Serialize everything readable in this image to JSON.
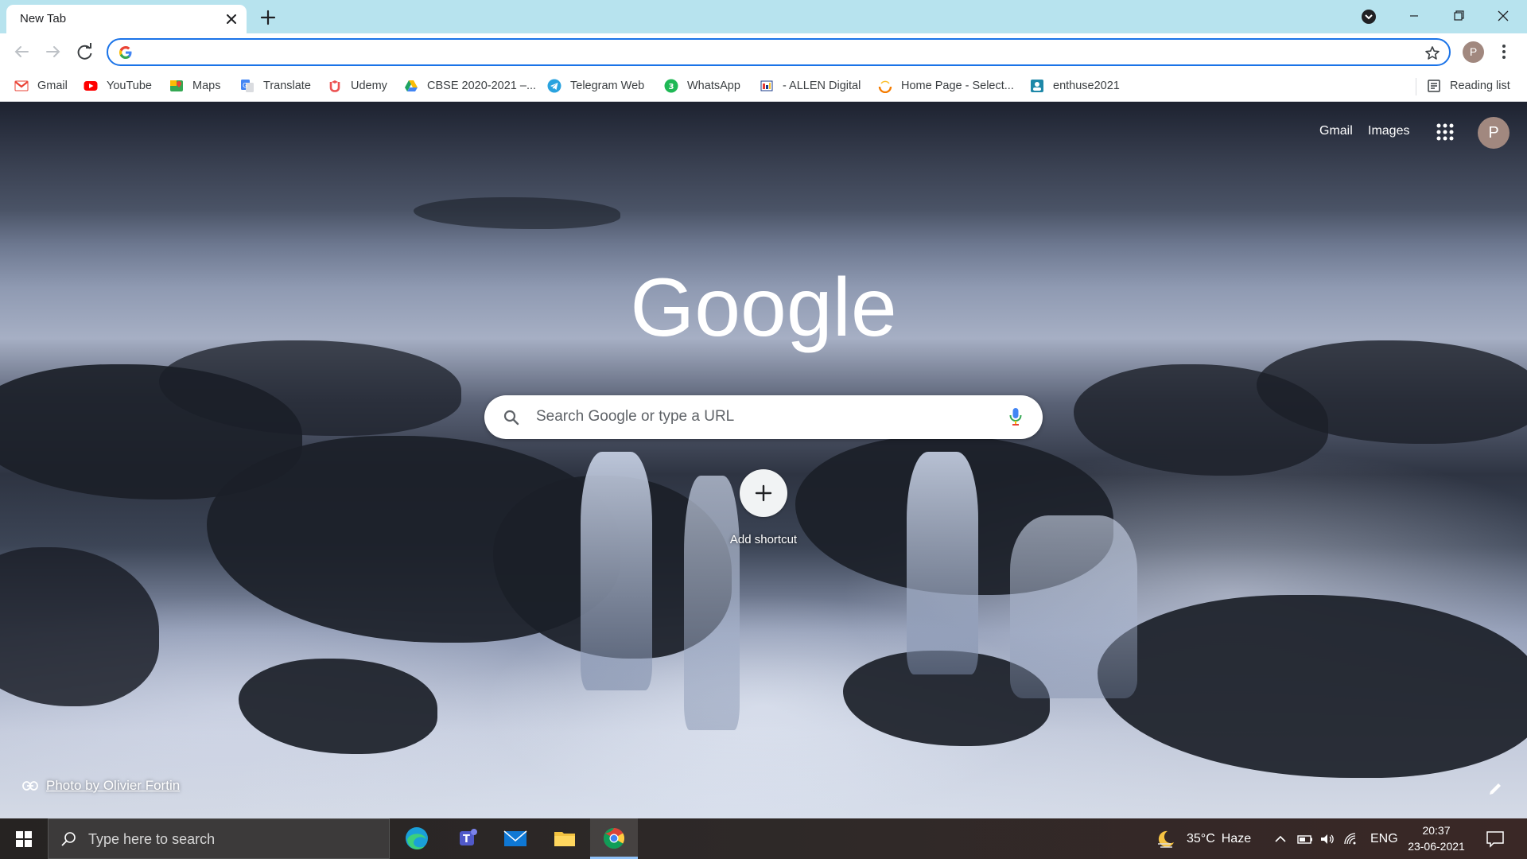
{
  "tab": {
    "title": "New Tab"
  },
  "omnibox": {
    "value": "",
    "placeholder": ""
  },
  "profile": {
    "initial": "P",
    "color": "#a1887f"
  },
  "bookmarks": [
    {
      "label": "Gmail",
      "icon": "gmail-icon"
    },
    {
      "label": "YouTube",
      "icon": "youtube-icon"
    },
    {
      "label": "Maps",
      "icon": "maps-icon"
    },
    {
      "label": "Translate",
      "icon": "translate-icon"
    },
    {
      "label": "Udemy",
      "icon": "udemy-icon"
    },
    {
      "label": "CBSE 2020-2021 –...",
      "icon": "drive-icon"
    },
    {
      "label": "Telegram Web",
      "icon": "telegram-icon"
    },
    {
      "label": "WhatsApp",
      "icon": "whatsapp-icon"
    },
    {
      "label": "- ALLEN Digital",
      "icon": "allen-icon"
    },
    {
      "label": "Home Page - Select...",
      "icon": "homepage-icon"
    },
    {
      "label": "enthuse2021",
      "icon": "enthuse-icon"
    }
  ],
  "reading_list": {
    "label": "Reading list"
  },
  "ntp": {
    "gmail_link": "Gmail",
    "images_link": "Images",
    "logo_text": "Google",
    "search_placeholder": "Search Google or type a URL",
    "shortcut_label": "Add shortcut",
    "photo_credit": "Photo by Olivier Fortin"
  },
  "taskbar": {
    "search_placeholder": "Type here to search",
    "apps": [
      "edge-icon",
      "teams-icon",
      "mail-icon",
      "file-explorer-icon",
      "chrome-icon"
    ],
    "weather": {
      "temp": "35°C",
      "condition": "Haze"
    },
    "language": "ENG",
    "time": "20:37",
    "date": "23-06-2021"
  }
}
